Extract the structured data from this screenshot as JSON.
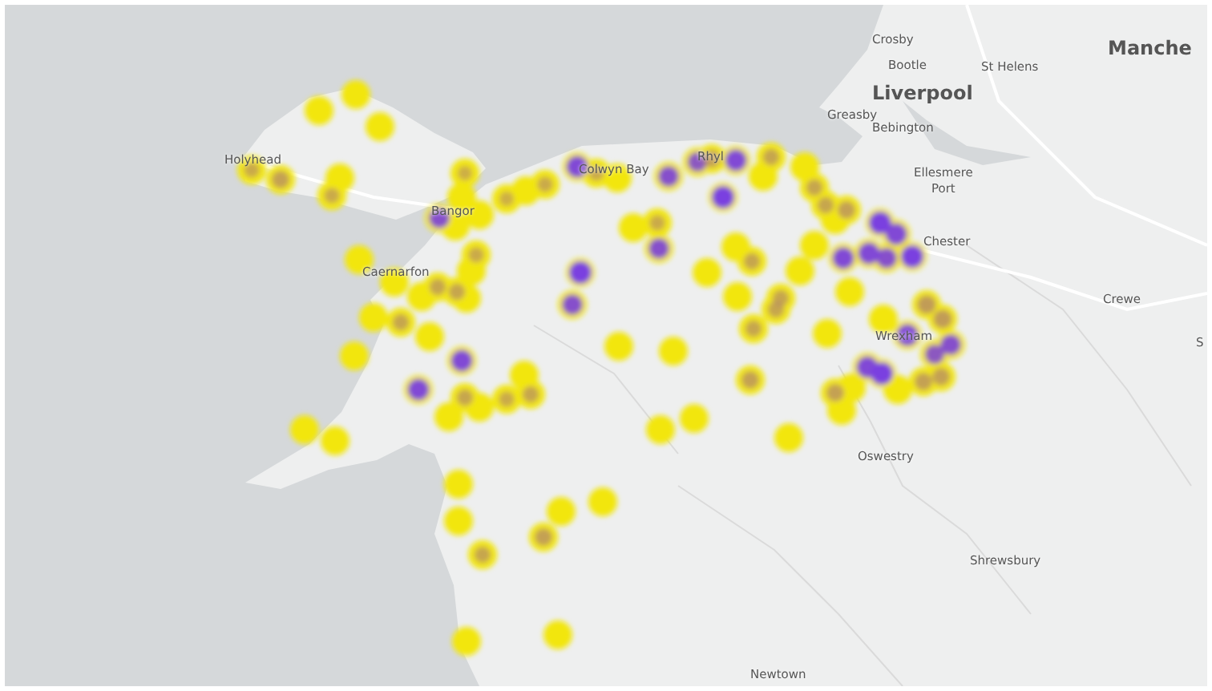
{
  "map": {
    "labels": [
      {
        "text": "Crosby",
        "kind": "town"
      },
      {
        "text": "Bootle",
        "kind": "town"
      },
      {
        "text": "St Helens",
        "kind": "town"
      },
      {
        "text": "Manche",
        "kind": "city"
      },
      {
        "text": "Liverpool",
        "kind": "city"
      },
      {
        "text": "Greasby",
        "kind": "town"
      },
      {
        "text": "Bebington",
        "kind": "town"
      },
      {
        "text": "Ellesmere\nPort",
        "kind": "town"
      },
      {
        "text": "Chester",
        "kind": "town"
      },
      {
        "text": "Crewe",
        "kind": "town"
      },
      {
        "text": "Wrexham",
        "kind": "town"
      },
      {
        "text": "S",
        "kind": "town"
      },
      {
        "text": "Oswestry",
        "kind": "town"
      },
      {
        "text": "Shrewsbury",
        "kind": "town"
      },
      {
        "text": "Newtown",
        "kind": "town"
      },
      {
        "text": "Holyhead",
        "kind": "town"
      },
      {
        "text": "Colwyn Bay",
        "kind": "town"
      },
      {
        "text": "Rhyl",
        "kind": "town"
      },
      {
        "text": "Bangor",
        "kind": "town"
      },
      {
        "text": "Caernarfon",
        "kind": "town"
      }
    ]
  }
}
